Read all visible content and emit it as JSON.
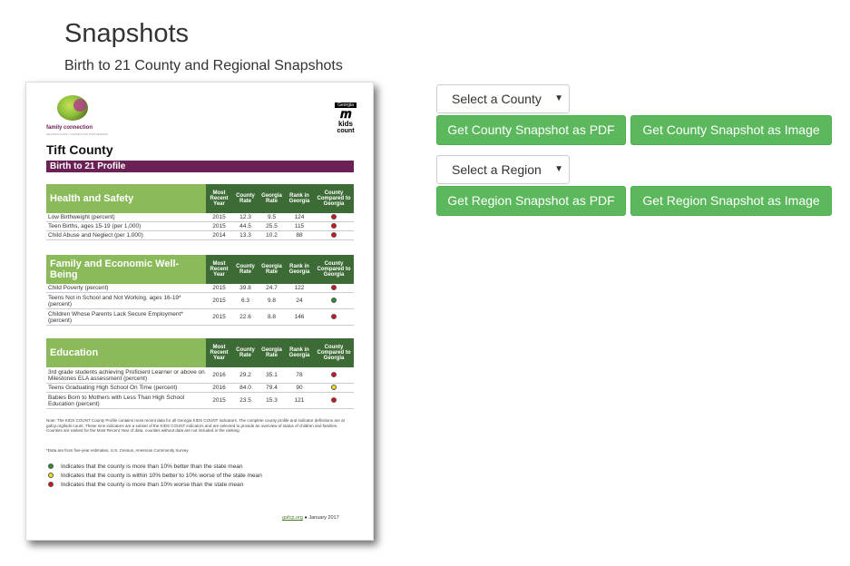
{
  "header": {
    "title": "Snapshots",
    "subtitle": "Birth to 21 County and Regional Snapshots"
  },
  "preview": {
    "logo_left_text": "family connection",
    "logo_left_sub": "GEORGIA FAMILY CONNECTION PARTNERSHIP",
    "logo_right_top": "Georgia",
    "logo_right_kids": "kids",
    "logo_right_count": "count",
    "county": "Tift County",
    "profile_title": "Birth to 21 Profile",
    "columns": [
      "Most Recent Year",
      "County Rate",
      "Georgia Rate",
      "Rank in Georgia",
      "County Compared to Georgia"
    ],
    "sections": [
      {
        "title": "Health and Safety",
        "rows": [
          {
            "label": "Low Birthweight (percent)",
            "year": "2015",
            "county": "12.3",
            "georgia": "9.5",
            "rank": "124",
            "status": "red"
          },
          {
            "label": "Teen Births, ages 15-19 (per 1,000)",
            "year": "2015",
            "county": "44.5",
            "georgia": "25.5",
            "rank": "115",
            "status": "red"
          },
          {
            "label": "Child Abuse and Neglect (per 1,000)",
            "year": "2014",
            "county": "13.3",
            "georgia": "10.2",
            "rank": "88",
            "status": "red"
          }
        ]
      },
      {
        "title": "Family and Economic Well-Being",
        "rows": [
          {
            "label": "Child Poverty (percent)",
            "year": "2015",
            "county": "39.8",
            "georgia": "24.7",
            "rank": "122",
            "status": "red"
          },
          {
            "label": "Teens Not in School and Not Working, ages 16-19* (percent)",
            "year": "2015",
            "county": "6.3",
            "georgia": "9.8",
            "rank": "24",
            "status": "green"
          },
          {
            "label": "Children Whose Parents Lack Secure Employment* (percent)",
            "year": "2015",
            "county": "22.6",
            "georgia": "8.8",
            "rank": "146",
            "status": "red"
          }
        ]
      },
      {
        "title": "Education",
        "rows": [
          {
            "label": "3rd grade students achieving Proficient Learner or above on Milestones ELA assessment (percent)",
            "year": "2016",
            "county": "29.2",
            "georgia": "35.1",
            "rank": "78",
            "status": "red"
          },
          {
            "label": "Teens Graduating High School On Time (percent)",
            "year": "2016",
            "county": "84.0",
            "georgia": "79.4",
            "rank": "90",
            "status": "yellow"
          },
          {
            "label": "Babies Born to Mothers with Less Than High School Education (percent)",
            "year": "2015",
            "county": "23.5",
            "georgia": "15.3",
            "rank": "121",
            "status": "red"
          }
        ]
      }
    ],
    "note": "Note: The KIDS COUNT County Profile contains most recent data for all Georgia KIDS COUNT indicators. The complete county profile and indicator definitions are at gafcp.org/kids-count. These nine indicators are a subset of the KIDS COUNT indicators and are selected to provide an overview of status of children and families. Counties are ranked for the Most Recent Year of data, counties without data are not included in the ranking.",
    "footnote": "*Data are from five-year estimates, U.S. Census, American Community Survey.",
    "legend": [
      {
        "status": "green",
        "text": "Indicates that the county is more than 10% better than the state mean"
      },
      {
        "status": "yellow",
        "text": "Indicates that the county is within 10% better to 10% worse of the state mean"
      },
      {
        "status": "red",
        "text": "Indicates that the county is more than 10% worse than the state mean"
      }
    ],
    "footer_site": "gafcp.org",
    "footer_date": "January 2017",
    "colors": {
      "green": "#2e8b3a",
      "yellow": "#f2e205",
      "red": "#d0101a",
      "profile_bar": "#6b2155",
      "section_light": "#8bba5a",
      "section_dark": "#3d6b35"
    }
  },
  "controls": {
    "county_select": "Select a County",
    "county_pdf": "Get County Snapshot as PDF",
    "county_image": "Get County Snapshot as Image",
    "region_select": "Select a Region",
    "region_pdf": "Get Region Snapshot as PDF",
    "region_image": "Get Region Snapshot as Image",
    "caret_icon": "▼"
  }
}
